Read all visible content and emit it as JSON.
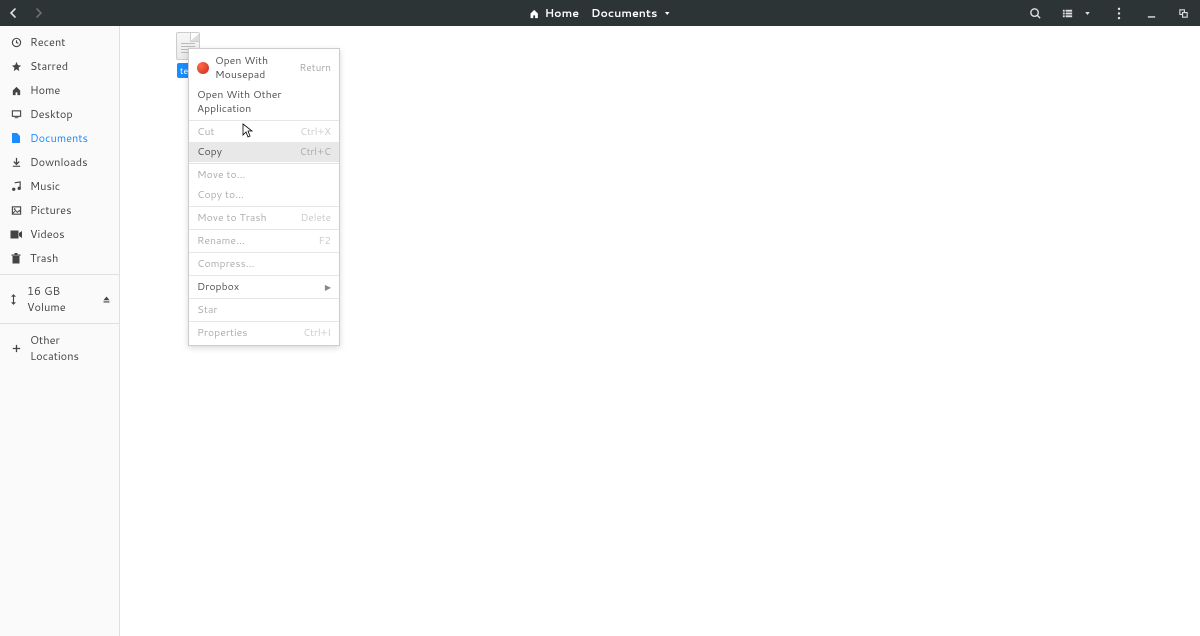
{
  "header": {
    "breadcrumb": [
      {
        "label": "Home",
        "icon": "home"
      },
      {
        "label": "Documents",
        "icon": null,
        "dropdown": true
      }
    ]
  },
  "sidebar": {
    "places": [
      {
        "label": "Recent",
        "icon": "recent"
      },
      {
        "label": "Starred",
        "icon": "star"
      },
      {
        "label": "Home",
        "icon": "home"
      },
      {
        "label": "Desktop",
        "icon": "desktop"
      },
      {
        "label": "Documents",
        "icon": "documents",
        "active": true
      },
      {
        "label": "Downloads",
        "icon": "downloads"
      },
      {
        "label": "Music",
        "icon": "music"
      },
      {
        "label": "Pictures",
        "icon": "pictures"
      },
      {
        "label": "Videos",
        "icon": "videos"
      },
      {
        "label": "Trash",
        "icon": "trash"
      }
    ],
    "volume": {
      "label": "16 GB Volume"
    },
    "other": {
      "label": "Other Locations"
    }
  },
  "file": {
    "label": "test"
  },
  "menu": {
    "items": [
      {
        "label": "Open With Mousepad",
        "shortcut": "Return",
        "app_icon": true
      },
      {
        "label": "Open With Other Application"
      },
      {
        "sep": true
      },
      {
        "label": "Cut",
        "shortcut": "Ctrl+X",
        "disabled": true
      },
      {
        "label": "Copy",
        "shortcut": "Ctrl+C",
        "hovered": true
      },
      {
        "sep": true
      },
      {
        "label": "Move to...",
        "disabled": true
      },
      {
        "label": "Copy to...",
        "disabled": true
      },
      {
        "sep": true
      },
      {
        "label": "Move to Trash",
        "shortcut": "Delete",
        "disabled": true
      },
      {
        "sep": true
      },
      {
        "label": "Rename...",
        "shortcut": "F2",
        "disabled": true
      },
      {
        "sep": true
      },
      {
        "label": "Compress...",
        "disabled": true
      },
      {
        "sep": true
      },
      {
        "label": "Dropbox",
        "submenu": true
      },
      {
        "sep": true
      },
      {
        "label": "Star",
        "disabled": true
      },
      {
        "sep": true
      },
      {
        "label": "Properties",
        "shortcut": "Ctrl+I",
        "disabled": true
      }
    ]
  }
}
